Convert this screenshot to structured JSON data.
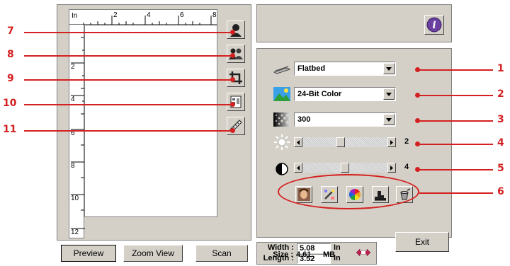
{
  "ruler": {
    "unit_label": "In",
    "top_numbers": [
      "2",
      "4",
      "6",
      "8"
    ],
    "left_numbers": [
      "2",
      "4",
      "6",
      "8",
      "10",
      "12"
    ]
  },
  "bottom_buttons": {
    "preview": "Preview",
    "zoom_view": "Zoom View",
    "scan": "Scan"
  },
  "settings": {
    "source": "Flatbed",
    "color_mode": "24-Bit Color",
    "resolution": "300",
    "brightness": 2,
    "brightness_fraction": 0.45,
    "contrast": 4,
    "contrast_fraction": 0.5
  },
  "size": {
    "width_label": "Width :",
    "width_value": "5.08",
    "width_unit": "In",
    "length_label": "Length :",
    "length_value": "3.52",
    "length_unit": "In",
    "size_label": "Size :",
    "size_value": "4.61",
    "size_unit": "MB"
  },
  "exit_label": "Exit",
  "callouts": {
    "c1": "1",
    "c2": "2",
    "c3": "3",
    "c4": "4",
    "c5": "5",
    "c6": "6",
    "c7": "7",
    "c8": "8",
    "c9": "9",
    "c10": "10",
    "c11": "11"
  },
  "colors": {
    "callout": "#d42020",
    "panel": "#d4d0c8",
    "info_icon": "#6a3fa0"
  }
}
